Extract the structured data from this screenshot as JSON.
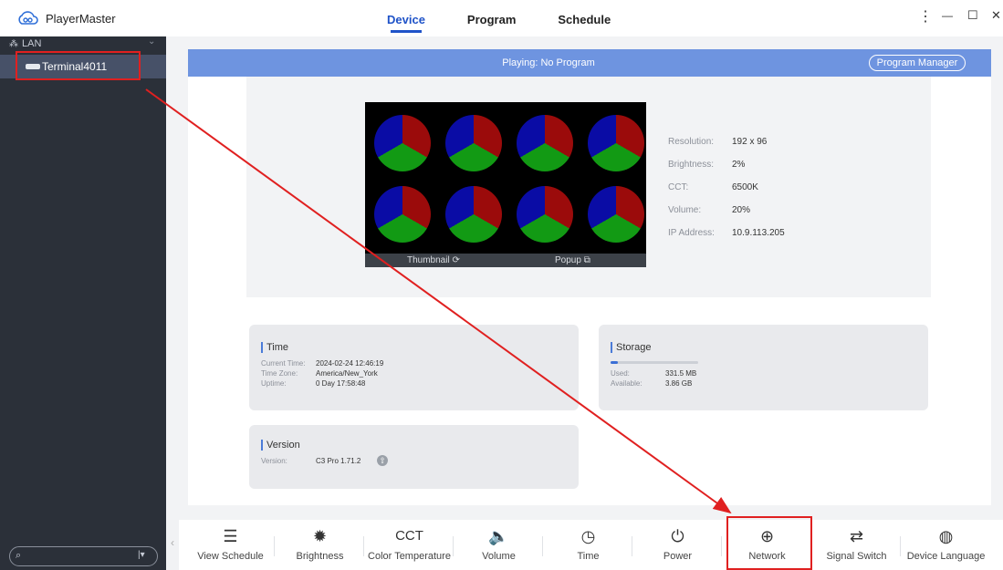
{
  "app": {
    "title": "PlayerMaster"
  },
  "tabs": [
    {
      "label": "Device",
      "active": true
    },
    {
      "label": "Program",
      "active": false
    },
    {
      "label": "Schedule",
      "active": false
    }
  ],
  "window_controls": {
    "menu": "⋮",
    "minimize": "—",
    "maximize": "☐",
    "close": "✕"
  },
  "sidebar": {
    "group_label": "LAN",
    "terminal_label": "Terminal4011",
    "search_icon": "search-icon",
    "filter_icon": "filter-icon"
  },
  "status": {
    "playing_text": "Playing: No Program",
    "program_manager_label": "Program Manager"
  },
  "thumbnail": {
    "thumbnail_label": "Thumbnail ⟳",
    "popup_label": "Popup ⧉",
    "pie_colors": [
      "#9b0b0b",
      "#129a14",
      "#0a0ca5"
    ]
  },
  "device_info": [
    {
      "label": "Resolution:",
      "value": "192 x 96"
    },
    {
      "label": "Brightness:",
      "value": "2%"
    },
    {
      "label": "CCT:",
      "value": "6500K"
    },
    {
      "label": "Volume:",
      "value": "20%"
    },
    {
      "label": "IP Address:",
      "value": "10.9.113.205"
    }
  ],
  "time_card": {
    "title": "Time",
    "rows": [
      {
        "label": "Current Time:",
        "value": "2024-02-24 12:46:19"
      },
      {
        "label": "Time Zone:",
        "value": "America/New_York"
      },
      {
        "label": "Uptime:",
        "value": "0 Day 17:58:48"
      }
    ]
  },
  "storage_card": {
    "title": "Storage",
    "used_fraction": 0.08,
    "rows": [
      {
        "label": "Used:",
        "value": "331.5 MB"
      },
      {
        "label": "Available:",
        "value": "3.86 GB"
      }
    ]
  },
  "version_card": {
    "title": "Version",
    "label": "Version:",
    "value": "C3 Pro 1.71.2"
  },
  "toolbar": [
    {
      "label": "View Schedule",
      "icon": "view-schedule-icon",
      "glyph": "☰"
    },
    {
      "label": "Brightness",
      "icon": "brightness-icon",
      "glyph": "✹"
    },
    {
      "label": "Color Temperature",
      "icon": "cct-icon",
      "glyph": "CCT"
    },
    {
      "label": "Volume",
      "icon": "volume-icon",
      "glyph": "🔈"
    },
    {
      "label": "Time",
      "icon": "clock-icon",
      "glyph": "◷"
    },
    {
      "label": "Power",
      "icon": "power-icon",
      "glyph": "⏻"
    },
    {
      "label": "Network",
      "icon": "network-globe-icon",
      "glyph": "⊕"
    },
    {
      "label": "Signal Switch",
      "icon": "signal-switch-icon",
      "glyph": "⇄"
    },
    {
      "label": "Device Language",
      "icon": "language-globe-icon",
      "glyph": "◍"
    }
  ],
  "colors": {
    "accent": "#1f53c8",
    "sidebar_bg": "#2b3039",
    "status_bar": "#6e94e0",
    "annotation_red": "#e02020"
  }
}
